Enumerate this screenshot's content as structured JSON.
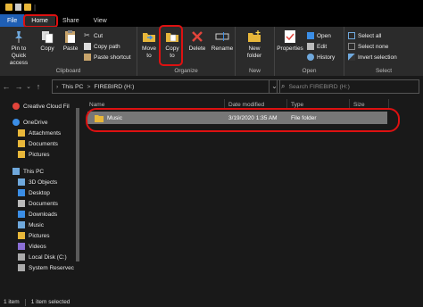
{
  "titlebar": {
    "title": "",
    "separator": "|"
  },
  "tabs": [
    {
      "label": "File"
    },
    {
      "label": "Home"
    },
    {
      "label": "Share"
    },
    {
      "label": "View"
    }
  ],
  "ribbon": {
    "clipboard": {
      "pin_label": "Pin to Quick access",
      "copy_label": "Copy",
      "paste_label": "Paste",
      "cut_label": "Cut",
      "copy_path_label": "Copy path",
      "paste_shortcut_label": "Paste shortcut",
      "group_label": "Clipboard"
    },
    "organize": {
      "move_to_label": "Move to",
      "copy_to_label": "Copy to",
      "delete_label": "Delete",
      "rename_label": "Rename",
      "group_label": "Organize"
    },
    "new": {
      "new_folder_label": "New folder",
      "group_label": "New"
    },
    "open": {
      "properties_label": "Properties",
      "open_label": "Open",
      "edit_label": "Edit",
      "history_label": "History",
      "group_label": "Open"
    },
    "select": {
      "select_all_label": "Select all",
      "select_none_label": "Select none",
      "invert_label": "Invert selection",
      "group_label": "Select"
    }
  },
  "address": {
    "crumbs": [
      "This PC",
      ">",
      "FIREBIRD (H:)"
    ],
    "search_placeholder": "Search FIREBIRD (H:)"
  },
  "nav": {
    "items": [
      {
        "label": "Creative Cloud Fil",
        "icon": "creative-cloud-icon",
        "color": "#e2443b"
      },
      {
        "label": "OneDrive",
        "icon": "cloud-icon",
        "color": "#3b8ee6"
      },
      {
        "label": "Attachments",
        "icon": "folder-icon",
        "color": "#e8b73a"
      },
      {
        "label": "Documents",
        "icon": "folder-icon",
        "color": "#e8b73a"
      },
      {
        "label": "Pictures",
        "icon": "folder-icon",
        "color": "#e8b73a"
      },
      {
        "label": "This PC",
        "icon": "computer-icon",
        "color": "#6fa8dc"
      },
      {
        "label": "3D Objects",
        "icon": "cube-icon",
        "color": "#6fa8dc"
      },
      {
        "label": "Desktop",
        "icon": "desktop-icon",
        "color": "#3b8ee6"
      },
      {
        "label": "Documents",
        "icon": "documents-icon",
        "color": "#bbbbbb"
      },
      {
        "label": "Downloads",
        "icon": "download-icon",
        "color": "#3b8ee6"
      },
      {
        "label": "Music",
        "icon": "music-icon",
        "color": "#6fa8dc"
      },
      {
        "label": "Pictures",
        "icon": "pictures-icon",
        "color": "#e8b73a"
      },
      {
        "label": "Videos",
        "icon": "videos-icon",
        "color": "#8b6fd6"
      },
      {
        "label": "Local Disk (C:)",
        "icon": "disk-icon",
        "color": "#aaaaaa"
      },
      {
        "label": "System Reservec",
        "icon": "disk-icon",
        "color": "#aaaaaa"
      }
    ]
  },
  "columns": {
    "name": "Name",
    "date": "Date modified",
    "type": "Type",
    "size": "Size"
  },
  "files": [
    {
      "name": "Music",
      "date": "3/19/2020 1:35 AM",
      "type": "File folder",
      "size": ""
    }
  ],
  "status": {
    "items": "1 item",
    "selected": "1 item selected"
  },
  "colors": {
    "accent": "#1f5fb5",
    "highlight_ring": "#dd1111",
    "folder": "#e8b73a",
    "selection": "#777777"
  }
}
